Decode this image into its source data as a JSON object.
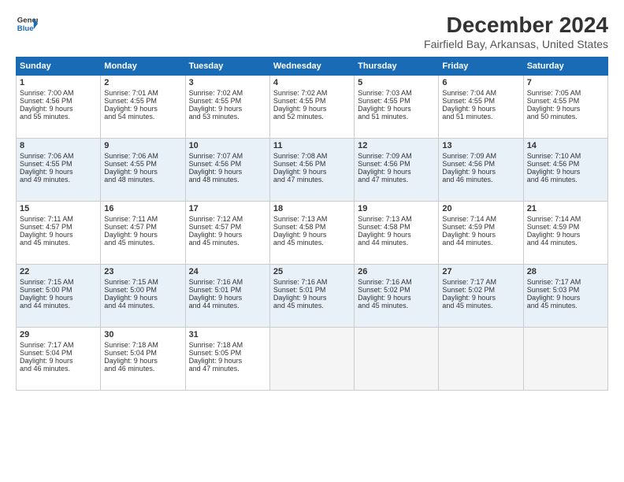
{
  "header": {
    "logo_line1": "General",
    "logo_line2": "Blue",
    "title": "December 2024",
    "subtitle": "Fairfield Bay, Arkansas, United States"
  },
  "days_of_week": [
    "Sunday",
    "Monday",
    "Tuesday",
    "Wednesday",
    "Thursday",
    "Friday",
    "Saturday"
  ],
  "weeks": [
    [
      {
        "day": "1",
        "lines": [
          "Sunrise: 7:00 AM",
          "Sunset: 4:56 PM",
          "Daylight: 9 hours",
          "and 55 minutes."
        ]
      },
      {
        "day": "2",
        "lines": [
          "Sunrise: 7:01 AM",
          "Sunset: 4:55 PM",
          "Daylight: 9 hours",
          "and 54 minutes."
        ]
      },
      {
        "day": "3",
        "lines": [
          "Sunrise: 7:02 AM",
          "Sunset: 4:55 PM",
          "Daylight: 9 hours",
          "and 53 minutes."
        ]
      },
      {
        "day": "4",
        "lines": [
          "Sunrise: 7:02 AM",
          "Sunset: 4:55 PM",
          "Daylight: 9 hours",
          "and 52 minutes."
        ]
      },
      {
        "day": "5",
        "lines": [
          "Sunrise: 7:03 AM",
          "Sunset: 4:55 PM",
          "Daylight: 9 hours",
          "and 51 minutes."
        ]
      },
      {
        "day": "6",
        "lines": [
          "Sunrise: 7:04 AM",
          "Sunset: 4:55 PM",
          "Daylight: 9 hours",
          "and 51 minutes."
        ]
      },
      {
        "day": "7",
        "lines": [
          "Sunrise: 7:05 AM",
          "Sunset: 4:55 PM",
          "Daylight: 9 hours",
          "and 50 minutes."
        ]
      }
    ],
    [
      {
        "day": "8",
        "lines": [
          "Sunrise: 7:06 AM",
          "Sunset: 4:55 PM",
          "Daylight: 9 hours",
          "and 49 minutes."
        ]
      },
      {
        "day": "9",
        "lines": [
          "Sunrise: 7:06 AM",
          "Sunset: 4:55 PM",
          "Daylight: 9 hours",
          "and 48 minutes."
        ]
      },
      {
        "day": "10",
        "lines": [
          "Sunrise: 7:07 AM",
          "Sunset: 4:56 PM",
          "Daylight: 9 hours",
          "and 48 minutes."
        ]
      },
      {
        "day": "11",
        "lines": [
          "Sunrise: 7:08 AM",
          "Sunset: 4:56 PM",
          "Daylight: 9 hours",
          "and 47 minutes."
        ]
      },
      {
        "day": "12",
        "lines": [
          "Sunrise: 7:09 AM",
          "Sunset: 4:56 PM",
          "Daylight: 9 hours",
          "and 47 minutes."
        ]
      },
      {
        "day": "13",
        "lines": [
          "Sunrise: 7:09 AM",
          "Sunset: 4:56 PM",
          "Daylight: 9 hours",
          "and 46 minutes."
        ]
      },
      {
        "day": "14",
        "lines": [
          "Sunrise: 7:10 AM",
          "Sunset: 4:56 PM",
          "Daylight: 9 hours",
          "and 46 minutes."
        ]
      }
    ],
    [
      {
        "day": "15",
        "lines": [
          "Sunrise: 7:11 AM",
          "Sunset: 4:57 PM",
          "Daylight: 9 hours",
          "and 45 minutes."
        ]
      },
      {
        "day": "16",
        "lines": [
          "Sunrise: 7:11 AM",
          "Sunset: 4:57 PM",
          "Daylight: 9 hours",
          "and 45 minutes."
        ]
      },
      {
        "day": "17",
        "lines": [
          "Sunrise: 7:12 AM",
          "Sunset: 4:57 PM",
          "Daylight: 9 hours",
          "and 45 minutes."
        ]
      },
      {
        "day": "18",
        "lines": [
          "Sunrise: 7:13 AM",
          "Sunset: 4:58 PM",
          "Daylight: 9 hours",
          "and 45 minutes."
        ]
      },
      {
        "day": "19",
        "lines": [
          "Sunrise: 7:13 AM",
          "Sunset: 4:58 PM",
          "Daylight: 9 hours",
          "and 44 minutes."
        ]
      },
      {
        "day": "20",
        "lines": [
          "Sunrise: 7:14 AM",
          "Sunset: 4:59 PM",
          "Daylight: 9 hours",
          "and 44 minutes."
        ]
      },
      {
        "day": "21",
        "lines": [
          "Sunrise: 7:14 AM",
          "Sunset: 4:59 PM",
          "Daylight: 9 hours",
          "and 44 minutes."
        ]
      }
    ],
    [
      {
        "day": "22",
        "lines": [
          "Sunrise: 7:15 AM",
          "Sunset: 5:00 PM",
          "Daylight: 9 hours",
          "and 44 minutes."
        ]
      },
      {
        "day": "23",
        "lines": [
          "Sunrise: 7:15 AM",
          "Sunset: 5:00 PM",
          "Daylight: 9 hours",
          "and 44 minutes."
        ]
      },
      {
        "day": "24",
        "lines": [
          "Sunrise: 7:16 AM",
          "Sunset: 5:01 PM",
          "Daylight: 9 hours",
          "and 44 minutes."
        ]
      },
      {
        "day": "25",
        "lines": [
          "Sunrise: 7:16 AM",
          "Sunset: 5:01 PM",
          "Daylight: 9 hours",
          "and 45 minutes."
        ]
      },
      {
        "day": "26",
        "lines": [
          "Sunrise: 7:16 AM",
          "Sunset: 5:02 PM",
          "Daylight: 9 hours",
          "and 45 minutes."
        ]
      },
      {
        "day": "27",
        "lines": [
          "Sunrise: 7:17 AM",
          "Sunset: 5:02 PM",
          "Daylight: 9 hours",
          "and 45 minutes."
        ]
      },
      {
        "day": "28",
        "lines": [
          "Sunrise: 7:17 AM",
          "Sunset: 5:03 PM",
          "Daylight: 9 hours",
          "and 45 minutes."
        ]
      }
    ],
    [
      {
        "day": "29",
        "lines": [
          "Sunrise: 7:17 AM",
          "Sunset: 5:04 PM",
          "Daylight: 9 hours",
          "and 46 minutes."
        ]
      },
      {
        "day": "30",
        "lines": [
          "Sunrise: 7:18 AM",
          "Sunset: 5:04 PM",
          "Daylight: 9 hours",
          "and 46 minutes."
        ]
      },
      {
        "day": "31",
        "lines": [
          "Sunrise: 7:18 AM",
          "Sunset: 5:05 PM",
          "Daylight: 9 hours",
          "and 47 minutes."
        ]
      },
      null,
      null,
      null,
      null
    ]
  ]
}
